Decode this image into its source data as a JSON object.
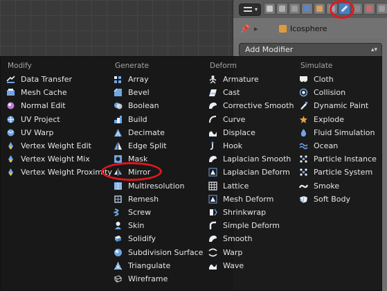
{
  "properties": {
    "object_name": "Icosphere",
    "add_modifier_label": "Add Modifier",
    "context_tabs": [
      {
        "name": "render-tab",
        "color": "#c9c9c9"
      },
      {
        "name": "render-layers-tab",
        "color": "#b0b0b0"
      },
      {
        "name": "scene-tab",
        "color": "#9c9c9c"
      },
      {
        "name": "world-tab",
        "color": "#5c86c2"
      },
      {
        "name": "object-tab",
        "color": "#d9a060"
      },
      {
        "name": "constraints-tab",
        "color": "#9aa0b0"
      },
      {
        "name": "modifiers-tab",
        "color": "#dfe7f3",
        "active": true
      },
      {
        "name": "data-tab",
        "color": "#8a8a8a"
      },
      {
        "name": "material-tab",
        "color": "#c96a6a"
      },
      {
        "name": "texture-tab",
        "color": "#9b9b9b"
      }
    ]
  },
  "menu": {
    "columns": [
      {
        "header": "Modify",
        "items": [
          {
            "label": "Data Transfer",
            "icon": "data-transfer-icon"
          },
          {
            "label": "Mesh Cache",
            "icon": "mesh-cache-icon"
          },
          {
            "label": "Normal Edit",
            "icon": "normal-edit-icon"
          },
          {
            "label": "UV Project",
            "icon": "uv-project-icon"
          },
          {
            "label": "UV Warp",
            "icon": "uv-warp-icon"
          },
          {
            "label": "Vertex Weight Edit",
            "icon": "vertex-weight-icon"
          },
          {
            "label": "Vertex Weight Mix",
            "icon": "vertex-weight-icon"
          },
          {
            "label": "Vertex Weight Proximity",
            "icon": "vertex-weight-icon"
          }
        ]
      },
      {
        "header": "Generate",
        "items": [
          {
            "label": "Array",
            "icon": "array-icon"
          },
          {
            "label": "Bevel",
            "icon": "bevel-icon"
          },
          {
            "label": "Boolean",
            "icon": "boolean-icon"
          },
          {
            "label": "Build",
            "icon": "build-icon"
          },
          {
            "label": "Decimate",
            "icon": "decimate-icon"
          },
          {
            "label": "Edge Split",
            "icon": "edge-split-icon"
          },
          {
            "label": "Mask",
            "icon": "mask-icon"
          },
          {
            "label": "Mirror",
            "icon": "mirror-icon",
            "highlight": true
          },
          {
            "label": "Multiresolution",
            "icon": "multires-icon"
          },
          {
            "label": "Remesh",
            "icon": "remesh-icon"
          },
          {
            "label": "Screw",
            "icon": "screw-icon"
          },
          {
            "label": "Skin",
            "icon": "skin-icon"
          },
          {
            "label": "Solidify",
            "icon": "solidify-icon"
          },
          {
            "label": "Subdivision Surface",
            "icon": "subsurf-icon"
          },
          {
            "label": "Triangulate",
            "icon": "triangulate-icon"
          },
          {
            "label": "Wireframe",
            "icon": "wireframe-icon"
          }
        ]
      },
      {
        "header": "Deform",
        "items": [
          {
            "label": "Armature",
            "icon": "armature-icon"
          },
          {
            "label": "Cast",
            "icon": "cast-icon"
          },
          {
            "label": "Corrective Smooth",
            "icon": "smooth-icon"
          },
          {
            "label": "Curve",
            "icon": "curve-icon"
          },
          {
            "label": "Displace",
            "icon": "displace-icon"
          },
          {
            "label": "Hook",
            "icon": "hook-icon"
          },
          {
            "label": "Laplacian Smooth",
            "icon": "smooth-icon"
          },
          {
            "label": "Laplacian Deform",
            "icon": "mesh-deform-icon"
          },
          {
            "label": "Lattice",
            "icon": "lattice-icon"
          },
          {
            "label": "Mesh Deform",
            "icon": "mesh-deform-icon"
          },
          {
            "label": "Shrinkwrap",
            "icon": "shrinkwrap-icon"
          },
          {
            "label": "Simple Deform",
            "icon": "simple-deform-icon"
          },
          {
            "label": "Smooth",
            "icon": "smooth-icon"
          },
          {
            "label": "Warp",
            "icon": "warp-icon"
          },
          {
            "label": "Wave",
            "icon": "wave-icon"
          }
        ]
      },
      {
        "header": "Simulate",
        "items": [
          {
            "label": "Cloth",
            "icon": "cloth-icon"
          },
          {
            "label": "Collision",
            "icon": "collision-icon"
          },
          {
            "label": "Dynamic Paint",
            "icon": "dynamic-paint-icon"
          },
          {
            "label": "Explode",
            "icon": "explode-icon"
          },
          {
            "label": "Fluid Simulation",
            "icon": "fluid-icon"
          },
          {
            "label": "Ocean",
            "icon": "ocean-icon"
          },
          {
            "label": "Particle Instance",
            "icon": "particles-icon"
          },
          {
            "label": "Particle System",
            "icon": "particles-icon"
          },
          {
            "label": "Smoke",
            "icon": "smoke-icon"
          },
          {
            "label": "Soft Body",
            "icon": "soft-body-icon"
          }
        ]
      }
    ]
  },
  "colors": {
    "highlight_circle": "#e2161c",
    "icon_blue": "#6fa6e6",
    "menu_bg": "#161616"
  }
}
